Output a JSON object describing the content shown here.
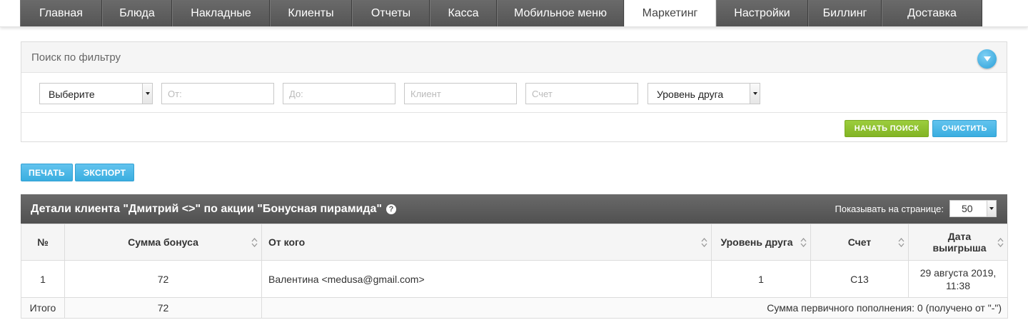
{
  "nav": {
    "tabs": [
      {
        "label": "Главная"
      },
      {
        "label": "Блюда"
      },
      {
        "label": "Накладные"
      },
      {
        "label": "Клиенты"
      },
      {
        "label": "Отчеты"
      },
      {
        "label": "Касса"
      },
      {
        "label": "Мобильное меню"
      },
      {
        "label": "Маркетинг",
        "active": true
      },
      {
        "label": "Настройки"
      },
      {
        "label": "Биллинг"
      },
      {
        "label": "Доставка"
      }
    ]
  },
  "filter": {
    "title": "Поиск по фильтру",
    "type_select": "Выберите",
    "from_placeholder": "От:",
    "to_placeholder": "До:",
    "client_placeholder": "Клиент",
    "bill_placeholder": "Счет",
    "level_select": "Уровень друга",
    "search_button": "Начать поиск",
    "clear_button": "Очистить"
  },
  "tools": {
    "print_button": "Печать",
    "export_button": "Экспорт"
  },
  "grid": {
    "title": "Детали клиента \"Дмитрий <>\" по акции \"Бонусная пирамида\"",
    "help_icon": "?",
    "per_page_label": "Показывать на странице:",
    "per_page_value": "50",
    "columns": {
      "num": "№",
      "bonus": "Сумма бонуса",
      "from": "От кого",
      "level": "Уровень друга",
      "bill": "Счет",
      "date": "Дата выигрыша"
    },
    "rows": [
      {
        "num": "1",
        "bonus": "72",
        "from": "Валентина <medusa@gmail.com>",
        "level": "1",
        "bill": "С13",
        "date": "29 августа 2019, 11:38"
      }
    ],
    "total": {
      "label": "Итого",
      "bonus": "72",
      "summary": "Сумма первичного пополнения: 0 (получено от \"-\")"
    }
  },
  "colors": {
    "tab_bg": "#5e5e5e",
    "accent_blue": "#3aaee0",
    "accent_green": "#82b424"
  }
}
